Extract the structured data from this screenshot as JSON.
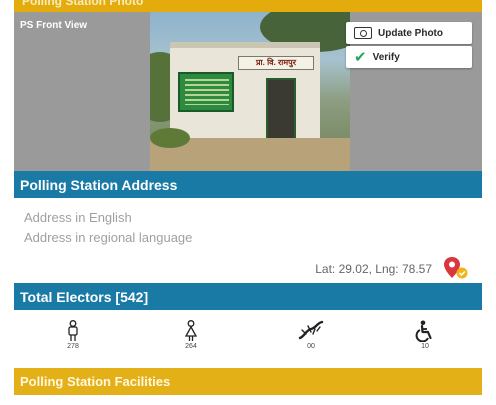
{
  "header": {
    "title": "Polling Station Photo"
  },
  "photo": {
    "label": "PS Front View",
    "sign_text": "प्रा. वि. रामपुर",
    "update_button": "Update Photo",
    "verify_button": "Verify"
  },
  "address": {
    "section_title": "Polling Station Address",
    "english_placeholder": "Address in English",
    "regional_placeholder": "Address in regional language",
    "latlng": "Lat: 29.02, Lng: 78.57"
  },
  "electors": {
    "section_title": "Total Electors [542]",
    "items": [
      {
        "icon": "male-icon",
        "count": "278"
      },
      {
        "icon": "female-icon",
        "count": "264"
      },
      {
        "icon": "third-gender-icon",
        "count": "00"
      },
      {
        "icon": "disabled-icon",
        "count": "10"
      }
    ]
  },
  "facilities": {
    "section_title": "Polling Station Facilities"
  },
  "colors": {
    "blue": "#1a7aa6",
    "yellow": "#e3ac0c",
    "green_check": "#26a65b",
    "pin_red": "#d9363e"
  }
}
